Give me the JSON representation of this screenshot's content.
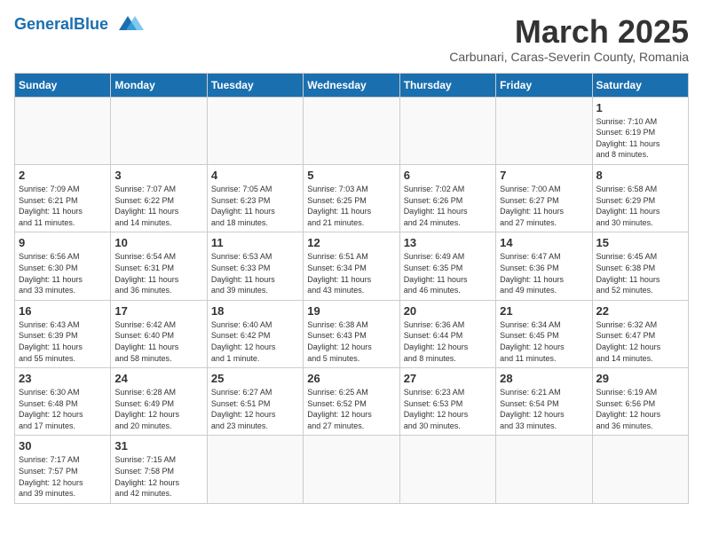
{
  "header": {
    "logo_general": "General",
    "logo_blue": "Blue",
    "month_title": "March 2025",
    "location": "Carbunari, Caras-Severin County, Romania"
  },
  "days_of_week": [
    "Sunday",
    "Monday",
    "Tuesday",
    "Wednesday",
    "Thursday",
    "Friday",
    "Saturday"
  ],
  "weeks": [
    [
      {
        "day": "",
        "info": ""
      },
      {
        "day": "",
        "info": ""
      },
      {
        "day": "",
        "info": ""
      },
      {
        "day": "",
        "info": ""
      },
      {
        "day": "",
        "info": ""
      },
      {
        "day": "",
        "info": ""
      },
      {
        "day": "1",
        "info": "Sunrise: 7:10 AM\nSunset: 6:19 PM\nDaylight: 11 hours\nand 8 minutes."
      }
    ],
    [
      {
        "day": "2",
        "info": "Sunrise: 7:09 AM\nSunset: 6:21 PM\nDaylight: 11 hours\nand 11 minutes."
      },
      {
        "day": "3",
        "info": "Sunrise: 7:07 AM\nSunset: 6:22 PM\nDaylight: 11 hours\nand 14 minutes."
      },
      {
        "day": "4",
        "info": "Sunrise: 7:05 AM\nSunset: 6:23 PM\nDaylight: 11 hours\nand 18 minutes."
      },
      {
        "day": "5",
        "info": "Sunrise: 7:03 AM\nSunset: 6:25 PM\nDaylight: 11 hours\nand 21 minutes."
      },
      {
        "day": "6",
        "info": "Sunrise: 7:02 AM\nSunset: 6:26 PM\nDaylight: 11 hours\nand 24 minutes."
      },
      {
        "day": "7",
        "info": "Sunrise: 7:00 AM\nSunset: 6:27 PM\nDaylight: 11 hours\nand 27 minutes."
      },
      {
        "day": "8",
        "info": "Sunrise: 6:58 AM\nSunset: 6:29 PM\nDaylight: 11 hours\nand 30 minutes."
      }
    ],
    [
      {
        "day": "9",
        "info": "Sunrise: 6:56 AM\nSunset: 6:30 PM\nDaylight: 11 hours\nand 33 minutes."
      },
      {
        "day": "10",
        "info": "Sunrise: 6:54 AM\nSunset: 6:31 PM\nDaylight: 11 hours\nand 36 minutes."
      },
      {
        "day": "11",
        "info": "Sunrise: 6:53 AM\nSunset: 6:33 PM\nDaylight: 11 hours\nand 39 minutes."
      },
      {
        "day": "12",
        "info": "Sunrise: 6:51 AM\nSunset: 6:34 PM\nDaylight: 11 hours\nand 43 minutes."
      },
      {
        "day": "13",
        "info": "Sunrise: 6:49 AM\nSunset: 6:35 PM\nDaylight: 11 hours\nand 46 minutes."
      },
      {
        "day": "14",
        "info": "Sunrise: 6:47 AM\nSunset: 6:36 PM\nDaylight: 11 hours\nand 49 minutes."
      },
      {
        "day": "15",
        "info": "Sunrise: 6:45 AM\nSunset: 6:38 PM\nDaylight: 11 hours\nand 52 minutes."
      }
    ],
    [
      {
        "day": "16",
        "info": "Sunrise: 6:43 AM\nSunset: 6:39 PM\nDaylight: 11 hours\nand 55 minutes."
      },
      {
        "day": "17",
        "info": "Sunrise: 6:42 AM\nSunset: 6:40 PM\nDaylight: 11 hours\nand 58 minutes."
      },
      {
        "day": "18",
        "info": "Sunrise: 6:40 AM\nSunset: 6:42 PM\nDaylight: 12 hours\nand 1 minute."
      },
      {
        "day": "19",
        "info": "Sunrise: 6:38 AM\nSunset: 6:43 PM\nDaylight: 12 hours\nand 5 minutes."
      },
      {
        "day": "20",
        "info": "Sunrise: 6:36 AM\nSunset: 6:44 PM\nDaylight: 12 hours\nand 8 minutes."
      },
      {
        "day": "21",
        "info": "Sunrise: 6:34 AM\nSunset: 6:45 PM\nDaylight: 12 hours\nand 11 minutes."
      },
      {
        "day": "22",
        "info": "Sunrise: 6:32 AM\nSunset: 6:47 PM\nDaylight: 12 hours\nand 14 minutes."
      }
    ],
    [
      {
        "day": "23",
        "info": "Sunrise: 6:30 AM\nSunset: 6:48 PM\nDaylight: 12 hours\nand 17 minutes."
      },
      {
        "day": "24",
        "info": "Sunrise: 6:28 AM\nSunset: 6:49 PM\nDaylight: 12 hours\nand 20 minutes."
      },
      {
        "day": "25",
        "info": "Sunrise: 6:27 AM\nSunset: 6:51 PM\nDaylight: 12 hours\nand 23 minutes."
      },
      {
        "day": "26",
        "info": "Sunrise: 6:25 AM\nSunset: 6:52 PM\nDaylight: 12 hours\nand 27 minutes."
      },
      {
        "day": "27",
        "info": "Sunrise: 6:23 AM\nSunset: 6:53 PM\nDaylight: 12 hours\nand 30 minutes."
      },
      {
        "day": "28",
        "info": "Sunrise: 6:21 AM\nSunset: 6:54 PM\nDaylight: 12 hours\nand 33 minutes."
      },
      {
        "day": "29",
        "info": "Sunrise: 6:19 AM\nSunset: 6:56 PM\nDaylight: 12 hours\nand 36 minutes."
      }
    ],
    [
      {
        "day": "30",
        "info": "Sunrise: 7:17 AM\nSunset: 7:57 PM\nDaylight: 12 hours\nand 39 minutes."
      },
      {
        "day": "31",
        "info": "Sunrise: 7:15 AM\nSunset: 7:58 PM\nDaylight: 12 hours\nand 42 minutes."
      },
      {
        "day": "",
        "info": ""
      },
      {
        "day": "",
        "info": ""
      },
      {
        "day": "",
        "info": ""
      },
      {
        "day": "",
        "info": ""
      },
      {
        "day": "",
        "info": ""
      }
    ]
  ]
}
